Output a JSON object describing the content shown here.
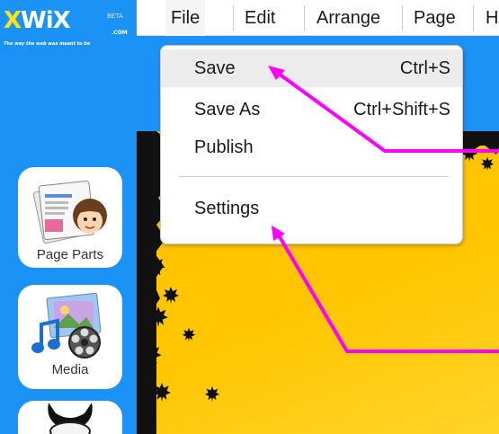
{
  "logo": {
    "word_x": "X",
    "word_rest": "WiX",
    "beta": "BETA",
    "com": ".COM",
    "tagline": "The way the web was meant to be"
  },
  "sidebar": {
    "items": [
      {
        "label": "Page Parts",
        "icon": "page-parts-icon"
      },
      {
        "label": "Media",
        "icon": "media-icon"
      },
      {
        "label": "",
        "icon": "character-icon"
      }
    ]
  },
  "menubar": {
    "items": [
      "File",
      "Edit",
      "Arrange",
      "Page",
      "H"
    ]
  },
  "file_menu": {
    "items": [
      {
        "label": "Save",
        "shortcut": "Ctrl+S"
      },
      {
        "label": "Save As",
        "shortcut": "Ctrl+Shift+S"
      },
      {
        "label": "Publish",
        "shortcut": ""
      },
      {
        "label": "Settings",
        "shortcut": ""
      }
    ]
  },
  "colors": {
    "panel_blue": "#1b92f5",
    "canvas_yellow": "#ffc400",
    "annotation_arrow": "#ff00ff",
    "leaf_black": "#111111"
  }
}
